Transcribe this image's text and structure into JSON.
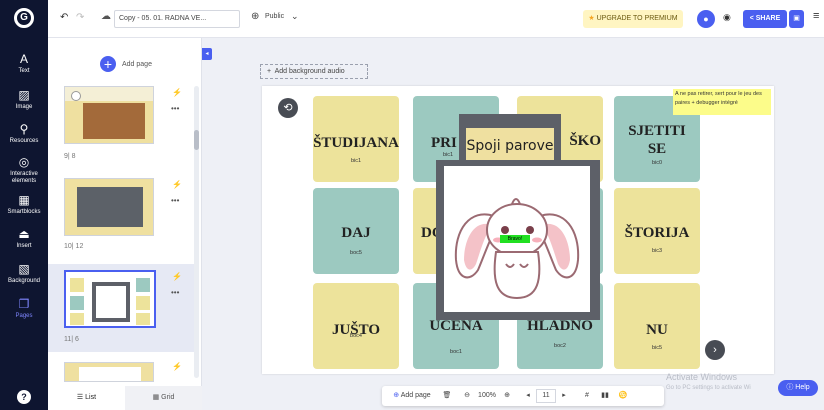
{
  "topbar": {
    "document_title": "Copy - 05. 01. RADNA VE...",
    "visibility": "Public",
    "upgrade_label": "UPGRADE TO PREMIUM",
    "share_label": "SHARE"
  },
  "leftnav": {
    "items": [
      {
        "label": "Text",
        "icon": "A"
      },
      {
        "label": "Image",
        "icon": "image-icon"
      },
      {
        "label": "Resources",
        "icon": "resources-icon"
      },
      {
        "label": "Interactive elements",
        "icon": "interactive-icon"
      },
      {
        "label": "Smartblocks",
        "icon": "smartblocks-icon"
      },
      {
        "label": "Insert",
        "icon": "insert-icon"
      },
      {
        "label": "Background",
        "icon": "background-icon"
      },
      {
        "label": "Pages",
        "icon": "pages-icon"
      }
    ],
    "help_icon": "?"
  },
  "pages_panel": {
    "add_page_label": "Add page",
    "pages": [
      {
        "label": "9| 8"
      },
      {
        "label": "10| 12"
      },
      {
        "label": "11| 6"
      }
    ],
    "list_label": "List",
    "grid_label": "Grid"
  },
  "canvas": {
    "add_background_audio": "Add background audio",
    "note": "A ne pas retirer, sert pour le jeu des paires + debugger intégré",
    "popup_title": "Spoji parove",
    "popup_badge": "Bravo!",
    "cards": [
      {
        "word": "ŠTUDIJANA",
        "sub": "bic1"
      },
      {
        "word": "PRI",
        "sub": "bic1"
      },
      {
        "word": "ŠKO",
        "sub": ""
      },
      {
        "word": "SJETITI SE",
        "sub": "bic0"
      },
      {
        "word": "DAJ",
        "sub": "boc5"
      },
      {
        "word": "DO",
        "sub": ""
      },
      {
        "word": "",
        "sub": ""
      },
      {
        "word": "ŠTORIJA",
        "sub": "bic3"
      },
      {
        "word": "JUŠTO",
        "sub": "boc4"
      },
      {
        "word": "UČENA",
        "sub": "boc1"
      },
      {
        "word": "HLADNO",
        "sub": "boc2"
      },
      {
        "word": "NU",
        "sub": "bic5"
      }
    ]
  },
  "bottombar": {
    "add_page": "Add page",
    "zoom": "100%",
    "page": "11"
  },
  "watermark": {
    "line1": "Activate Windows",
    "line2": "Go to PC settings to activate Wi"
  },
  "help_button": "Help",
  "colors": {
    "accent": "#4a5ff0",
    "nav_bg": "#0e1530",
    "card_yellow": "#ede39b",
    "card_teal": "#9cc9c0",
    "popup_frame": "#5d6068",
    "upgrade_bg": "#fff5c2"
  }
}
